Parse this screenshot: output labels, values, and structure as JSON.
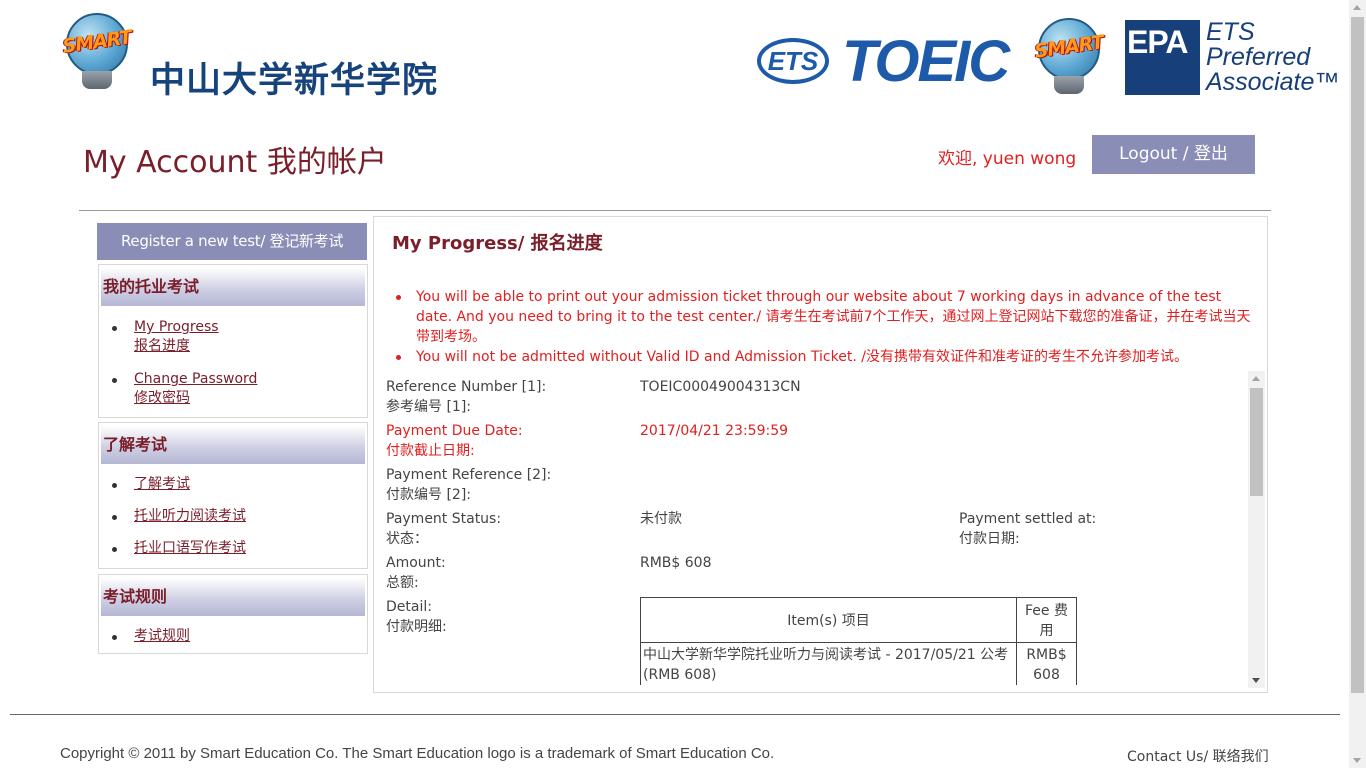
{
  "header": {
    "smart_logo_text": "SMART",
    "school_name": "中山大学新华学院",
    "ets_logo_text": "ETS",
    "toeic_logo_text": "TOEIC",
    "epa_logo_text": "EPA",
    "ets_preferred_lines": [
      "ETS",
      "Preferred",
      "Associate™"
    ]
  },
  "account": {
    "page_title": "My Account 我的帐户",
    "welcome": "欢迎, yuen wong",
    "logout_label": "Logout / 登出"
  },
  "sidebar": {
    "register_label": "Register a new test/ 登记新考试",
    "sections": [
      {
        "title": "我的托业考试",
        "items": [
          {
            "label": "My Progress",
            "sub": "报名进度"
          },
          {
            "label": "Change Password",
            "sub": "修改密码"
          }
        ]
      },
      {
        "title": "了解考试",
        "items": [
          {
            "label": "了解考试"
          },
          {
            "label": "托业听力阅读考试"
          },
          {
            "label": "托业口语写作考试"
          }
        ]
      },
      {
        "title": "考试规则",
        "items": [
          {
            "label": "考试规则"
          }
        ]
      }
    ]
  },
  "main": {
    "title": "My Progress/ 报名进度",
    "notices": [
      "You will be able to print out your admission ticket through our website about 7 working days in advance of the test date. And you need to bring it to the test center./ 请考生在考试前7个工作天，通过网上登记网站下载您的准备证，并在考试当天带到考场。",
      "You will not be admitted without Valid ID and Admission Ticket. /没有携带有效证件和准考证的考生不允许参加考试。"
    ],
    "details": {
      "reference_label": "Reference Number [1]:",
      "reference_label_cn": "参考编号 [1]:",
      "reference_value": "TOEIC00049004313CN",
      "due_label": "Payment Due Date:",
      "due_label_cn": "付款截止日期:",
      "due_value": "2017/04/21 23:59:59",
      "payref_label": "Payment Reference [2]:",
      "payref_label_cn": "付款编号 [2]:",
      "status_label": "Payment Status:",
      "status_label_cn": "状态：",
      "status_value": "未付款",
      "settled_label": "Payment settled at:",
      "settled_label_cn": "付款日期:",
      "amount_label": "Amount:",
      "amount_label_cn": "总额:",
      "amount_value": "RMB$ 608",
      "detail_label": "Detail:",
      "detail_label_cn": "付款明细:"
    },
    "fee_table": {
      "headers": [
        "Item(s) 项目",
        "Fee 费用"
      ],
      "rows": [
        {
          "item": "中山大学新华学院托业听力与阅读考试 - 2017/05/21 公考 (RMB 608)",
          "fee": "RMB$ 608"
        }
      ]
    }
  },
  "footer": {
    "copyright": "Copyright © 2011 by Smart Education Co. The Smart Education logo is a trademark of Smart Education Co.",
    "contact": "Contact Us/ 联络我们"
  },
  "colors": {
    "maroon": "#7a1e2a",
    "accent_red": "#e02020",
    "button_purple": "#8a8db6",
    "navy": "#17437c",
    "ets_blue": "#1d5aa9"
  }
}
